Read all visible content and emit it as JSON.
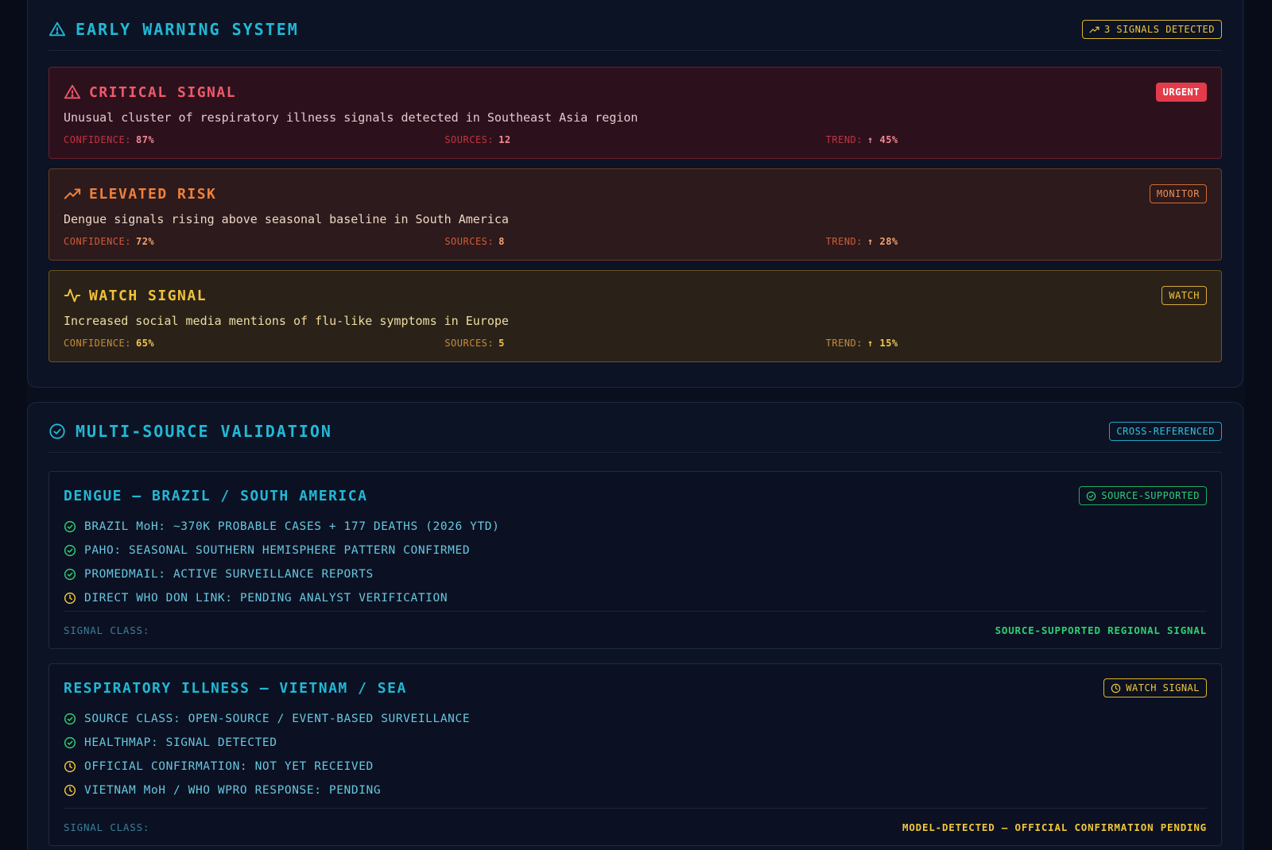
{
  "early_warning": {
    "title": "EARLY WARNING SYSTEM",
    "badge": "3 SIGNALS DETECTED",
    "alerts": [
      {
        "title": "CRITICAL SIGNAL",
        "badge": "URGENT",
        "description": "Unusual cluster of respiratory illness signals detected in Southeast Asia region",
        "confidence_label": "CONFIDENCE:",
        "confidence": "87%",
        "sources_label": "SOURCES:",
        "sources": "12",
        "trend_label": "TREND:",
        "trend": "↑ 45%"
      },
      {
        "title": "ELEVATED RISK",
        "badge": "MONITOR",
        "description": "Dengue signals rising above seasonal baseline in South America",
        "confidence_label": "CONFIDENCE:",
        "confidence": "72%",
        "sources_label": "SOURCES:",
        "sources": "8",
        "trend_label": "TREND:",
        "trend": "↑ 28%"
      },
      {
        "title": "WATCH SIGNAL",
        "badge": "WATCH",
        "description": "Increased social media mentions of flu-like symptoms in Europe",
        "confidence_label": "CONFIDENCE:",
        "confidence": "65%",
        "sources_label": "SOURCES:",
        "sources": "5",
        "trend_label": "TREND:",
        "trend": "↑ 15%"
      }
    ]
  },
  "validation": {
    "title": "MULTI-SOURCE VALIDATION",
    "badge": "CROSS-REFERENCED",
    "cards": [
      {
        "title": "DENGUE — BRAZIL / SOUTH AMERICA",
        "badge": "SOURCE-SUPPORTED",
        "items": [
          {
            "status": "check-circle-icon",
            "text": "BRAZIL MoH: ~370K PROBABLE CASES + 177 DEATHS (2026 YTD)"
          },
          {
            "status": "check-circle-icon",
            "text": "PAHO: SEASONAL SOUTHERN HEMISPHERE PATTERN CONFIRMED"
          },
          {
            "status": "check-circle-icon",
            "text": "PROMEDMAIL: ACTIVE SURVEILLANCE REPORTS"
          },
          {
            "status": "clock-icon",
            "text": "DIRECT WHO DON LINK: PENDING ANALYST VERIFICATION"
          }
        ],
        "signal_class_label": "SIGNAL CLASS:",
        "signal_class_value": "SOURCE-SUPPORTED REGIONAL SIGNAL"
      },
      {
        "title": "RESPIRATORY ILLNESS — VIETNAM / SEA",
        "badge": "WATCH SIGNAL",
        "items": [
          {
            "status": "check-circle-icon",
            "text": "SOURCE CLASS: OPEN-SOURCE / EVENT-BASED SURVEILLANCE"
          },
          {
            "status": "check-circle-icon",
            "text": "HEALTHMAP: SIGNAL DETECTED"
          },
          {
            "status": "clock-icon",
            "text": "OFFICIAL CONFIRMATION: NOT YET RECEIVED"
          },
          {
            "status": "clock-icon",
            "text": "VIETNAM MoH / WHO WPRO RESPONSE: PENDING"
          }
        ],
        "signal_class_label": "SIGNAL CLASS:",
        "signal_class_value": "MODEL-DETECTED — OFFICIAL CONFIRMATION PENDING"
      }
    ]
  },
  "colors": {
    "background": "#0a0f1e",
    "accent_cyan": "#22b8d6",
    "critical": "#f05a6a",
    "elevated": "#f0803a",
    "watch": "#f0c23a",
    "supported": "#2fcf74"
  }
}
